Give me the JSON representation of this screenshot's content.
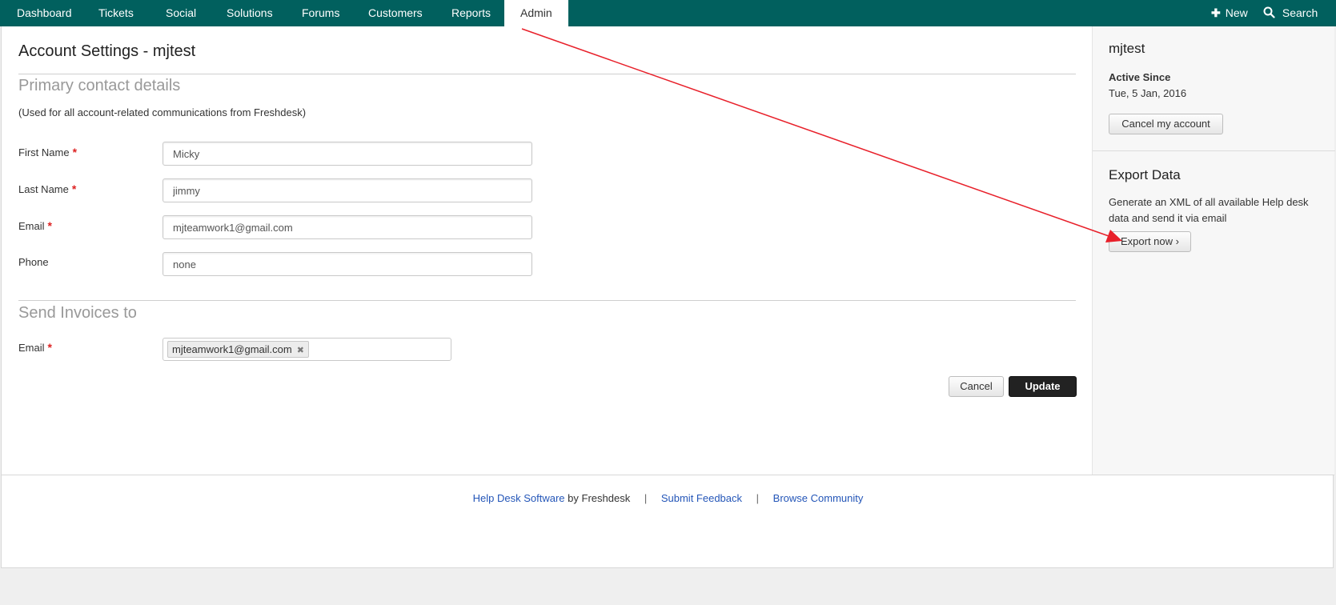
{
  "nav": {
    "items": [
      {
        "label": "Dashboard"
      },
      {
        "label": "Tickets"
      },
      {
        "label": "Social"
      },
      {
        "label": "Solutions"
      },
      {
        "label": "Forums"
      },
      {
        "label": "Customers"
      },
      {
        "label": "Reports"
      },
      {
        "label": "Admin",
        "active": true
      }
    ],
    "new_label": "New",
    "search_label": "Search"
  },
  "main": {
    "title": "Account Settings - mjtest",
    "primary_heading": "Primary contact details",
    "primary_hint": "(Used for all account-related communications from Freshdesk)",
    "fields": {
      "first_name": {
        "label": "First Name",
        "value": "Micky"
      },
      "last_name": {
        "label": "Last Name",
        "value": "jimmy"
      },
      "email": {
        "label": "Email",
        "value": "mjteamwork1@gmail.com"
      },
      "phone": {
        "label": "Phone",
        "value": "none"
      }
    },
    "invoice_heading": "Send Invoices to",
    "invoice_email_label": "Email",
    "invoice_email_tag": "mjteamwork1@gmail.com",
    "cancel_label": "Cancel",
    "update_label": "Update"
  },
  "sidebar": {
    "account_name": "mjtest",
    "active_since_label": "Active Since",
    "active_since_value": "Tue, 5 Jan, 2016",
    "cancel_account_label": "Cancel my account",
    "export_heading": "Export Data",
    "export_description": "Generate an XML of all available Help desk data and send it via email",
    "export_button_label": "Export now ›"
  },
  "footer": {
    "link_helpdesk": "Help Desk Software",
    "by_text": "by Freshdesk",
    "separator": "|",
    "link_feedback": "Submit Feedback",
    "link_community": "Browse Community"
  },
  "colors": {
    "nav_bg": "#01605e",
    "primary_button": "#222222",
    "link": "#2456b8",
    "required_marker": "#dd2222",
    "annotation_arrow": "#e8202a"
  },
  "icons": {
    "new": "plus-icon",
    "search": "search-icon",
    "tag_remove": "close-icon"
  }
}
